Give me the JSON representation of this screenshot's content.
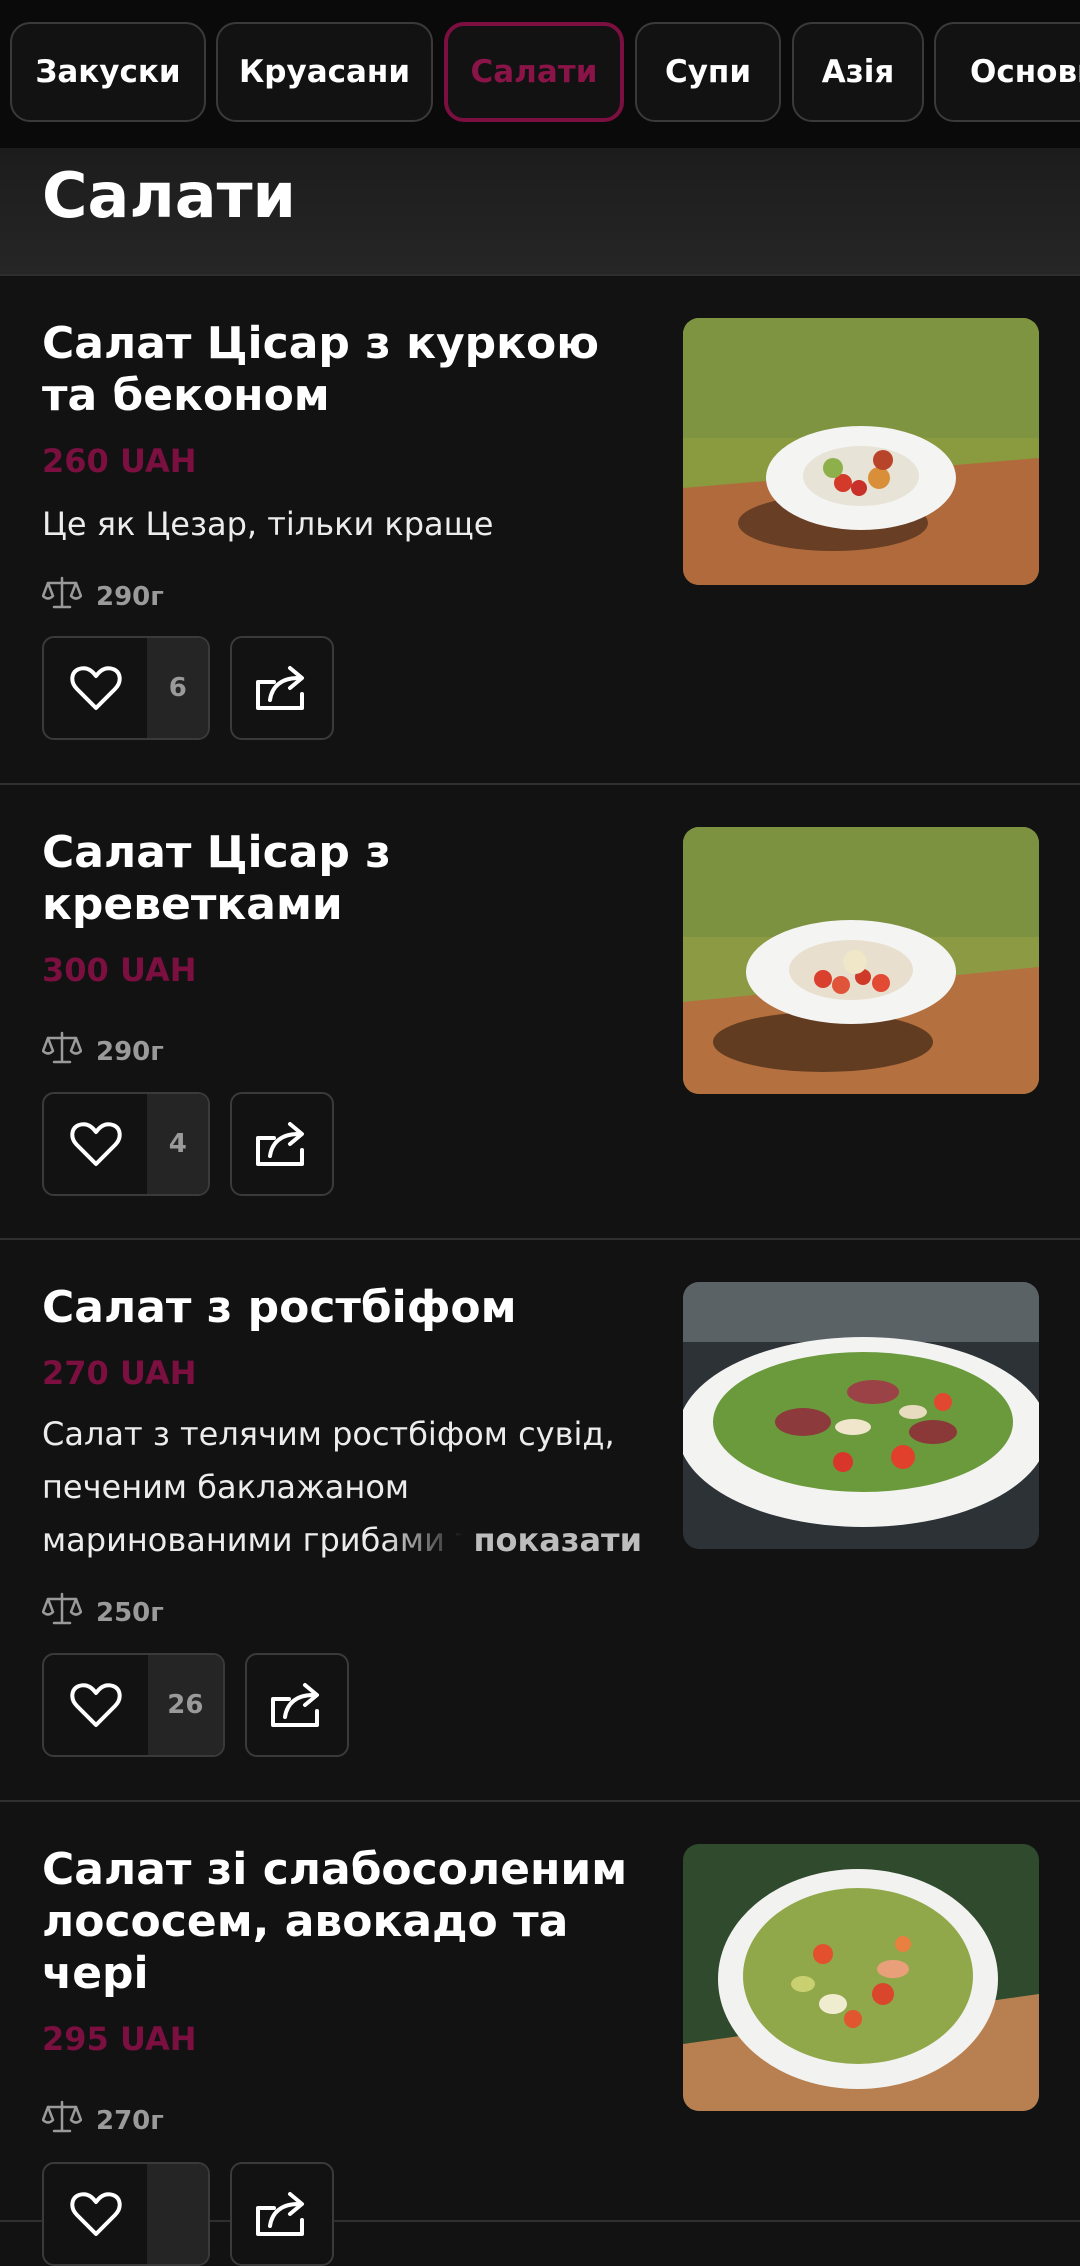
{
  "categories": [
    {
      "label": "Закуски",
      "active": false
    },
    {
      "label": "Круасани",
      "active": false
    },
    {
      "label": "Салати",
      "active": true
    },
    {
      "label": "Супи",
      "active": false
    },
    {
      "label": "Азія",
      "active": false
    },
    {
      "label": "Основн",
      "active": false
    }
  ],
  "section": {
    "title": "Салати"
  },
  "items": [
    {
      "name": "Салат Цісар з куркою та беконом",
      "price": "260 UAH",
      "description": "Це як Цезар, тільки краще",
      "weight": "290г",
      "likes": "6"
    },
    {
      "name": "Салат Цісар з креветками",
      "price": "300 UAH",
      "weight": "290г",
      "likes": "4"
    },
    {
      "name": "Салат з ростбіфом",
      "price": "270 UAH",
      "description": "Салат з телячим ростбіфом сувід, печеним баклажаном маринованими грибами та",
      "more_label": "показати",
      "weight": "250г",
      "likes": "26"
    },
    {
      "name": "Салат зі слабосоленим лососем, авокадо та чері",
      "price": "295 UAH",
      "weight": "270г"
    }
  ],
  "colors": {
    "accent": "#7a0f40",
    "background": "#121212"
  }
}
